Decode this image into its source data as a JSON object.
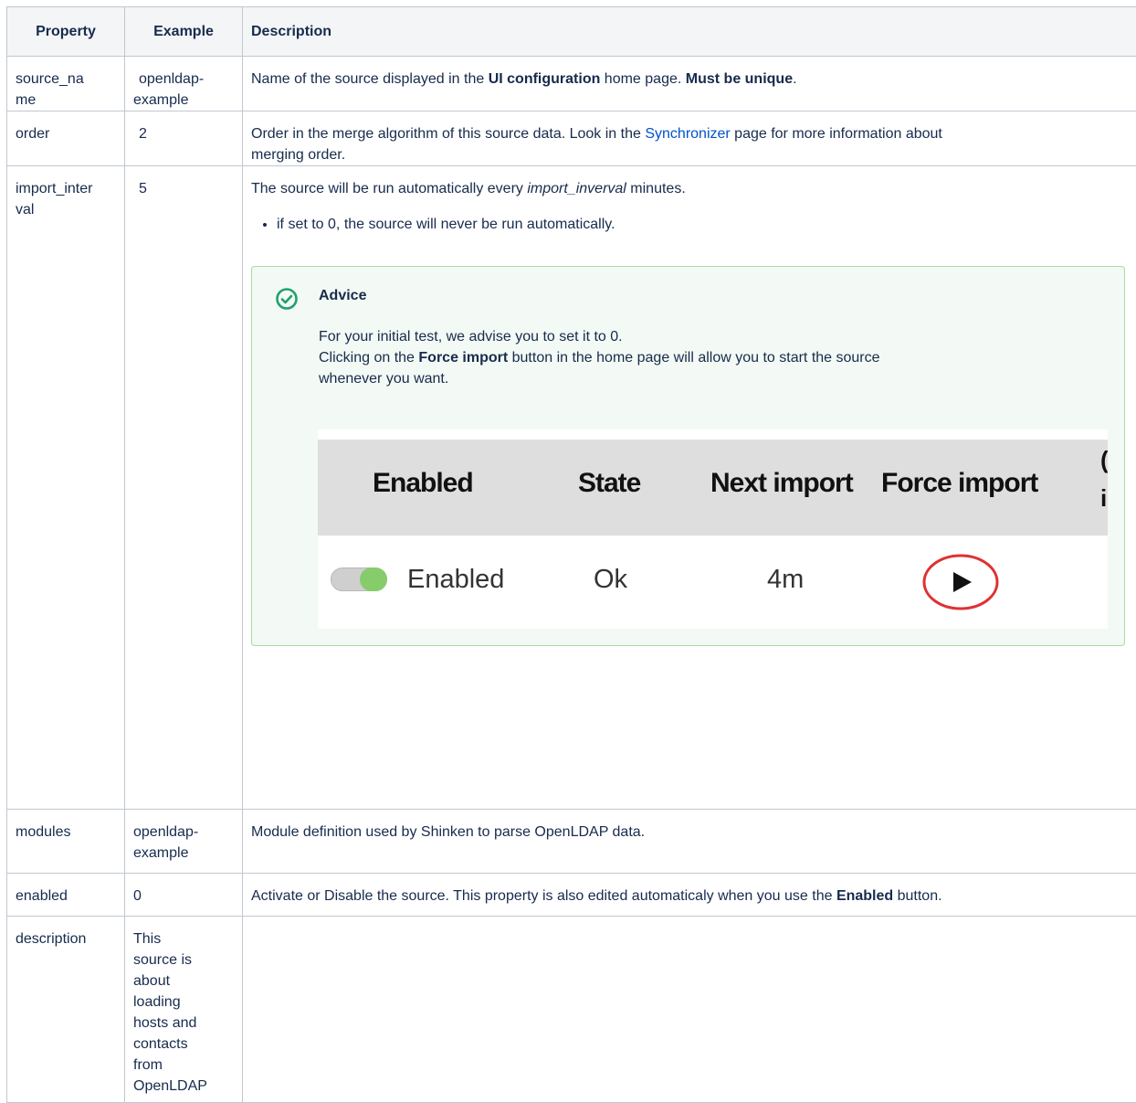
{
  "headers": {
    "property": "Property",
    "example": "Example",
    "description": "Description"
  },
  "rows": {
    "source_name": {
      "property_l1": "source_na",
      "property_l2": "me",
      "example_l1": "openldap-",
      "example_l2": "example",
      "desc_a": "Name of the source displayed in the ",
      "desc_b": "UI configuration",
      "desc_c": " home page. ",
      "desc_d": "Must be unique",
      "desc_e": "."
    },
    "order": {
      "property": "order",
      "example": "2",
      "desc_a": "Order in the merge algorithm of this source data. Look in the ",
      "desc_link": "Synchronizer",
      "desc_b": " page for more information about",
      "desc_c": "merging order."
    },
    "import_interval": {
      "property_l1": "import_inter",
      "property_l2": "val",
      "example": "5",
      "desc_a": "The source will be run automatically every ",
      "desc_em": "import_inverval",
      "desc_b": " minutes.",
      "bullet": "if set to 0, the source will never be run automatically.",
      "advice": {
        "title": "Advice",
        "line1": "For your initial test, we advise you to set it to 0.",
        "line2a": "Clicking on the ",
        "line2b": "Force import",
        "line2c": " button in the home page will allow you to start the source",
        "line3": "whenever you want.",
        "screenshot": {
          "headers": [
            "Enabled",
            "State",
            "Next import",
            "Force import"
          ],
          "values": {
            "enabled": "Enabled",
            "state": "Ok",
            "next_import": "4m"
          },
          "cut_text_1": "(",
          "cut_text_2": "i",
          "toggle_color": "#86cc6b",
          "highlight_color": "#e03131"
        }
      }
    },
    "modules": {
      "property": "modules",
      "example_l1": "openldap-",
      "example_l2": "example",
      "desc": "Module definition used by Shinken to parse OpenLDAP data."
    },
    "enabled": {
      "property": "enabled",
      "example": "0",
      "desc_a": "Activate or Disable the source. This property is also edited automaticaly when you use the ",
      "desc_b": "Enabled",
      "desc_c": " button."
    },
    "description": {
      "property": "description",
      "example_lines": [
        "This",
        "source is",
        "about",
        "loading",
        "hosts and",
        "contacts",
        "from",
        "OpenLDAP"
      ]
    }
  },
  "colors": {
    "link": "#0052cc",
    "advice_border": "#abd8a6",
    "advice_bg": "#f3f9f4",
    "header_bg": "#f4f5f7"
  }
}
